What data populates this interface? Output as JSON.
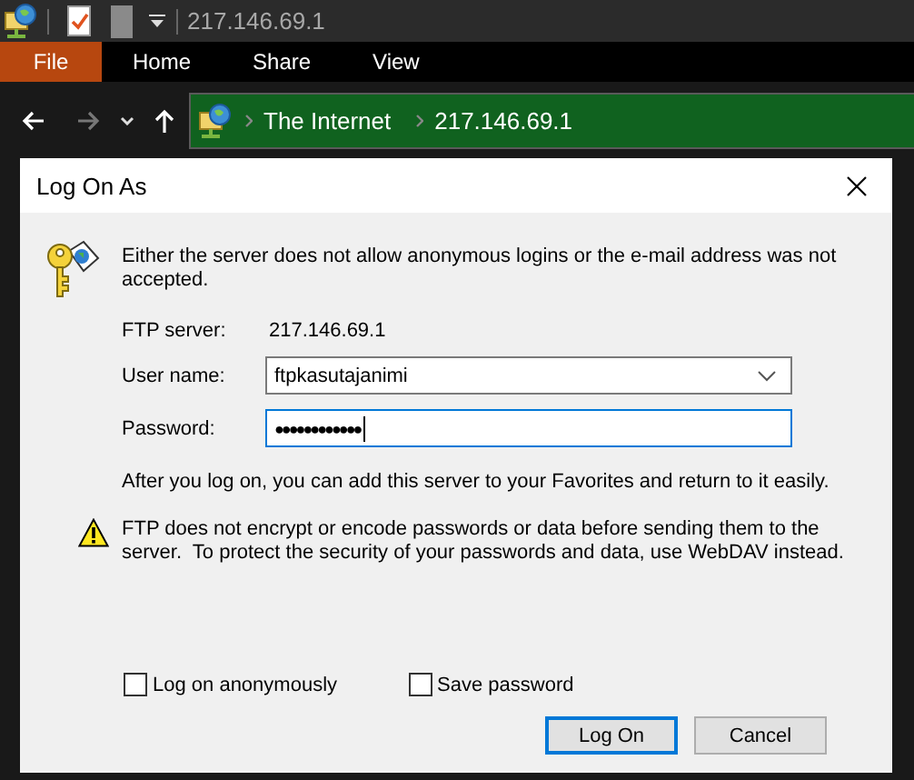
{
  "title_bar": {
    "title": "217.146.69.1"
  },
  "ribbon": {
    "tabs": [
      {
        "label": "File",
        "selected": true
      },
      {
        "label": "Home",
        "selected": false
      },
      {
        "label": "Share",
        "selected": false
      },
      {
        "label": "View",
        "selected": false
      }
    ]
  },
  "navigation": {
    "forward_disabled": true,
    "breadcrumbs": [
      "The Internet",
      "217.146.69.1"
    ]
  },
  "dialog": {
    "title": "Log On As",
    "message": "Either the server does not allow anonymous logins or the e-mail address was not accepted.",
    "fields": [
      {
        "kind": "static",
        "label": "FTP server:",
        "value": "217.146.69.1"
      },
      {
        "kind": "combo",
        "label": "User name:",
        "value": "ftpkasutajanimi",
        "focused": false
      },
      {
        "kind": "password",
        "label": "Password:",
        "value": "●●●●●●●●●●●●",
        "focused": true
      }
    ],
    "info": "After you log on, you can add this server to your Favorites and return to it easily.",
    "warning": "FTP does not encrypt or encode passwords or data before sending them to the server.  To protect the security of your passwords and data, use WebDAV instead.",
    "checkboxes": [
      {
        "label": "Log on anonymously",
        "checked": false
      },
      {
        "label": "Save password",
        "checked": false
      }
    ],
    "buttons": [
      {
        "label": "Log On",
        "default": true
      },
      {
        "label": "Cancel",
        "default": false
      }
    ]
  }
}
